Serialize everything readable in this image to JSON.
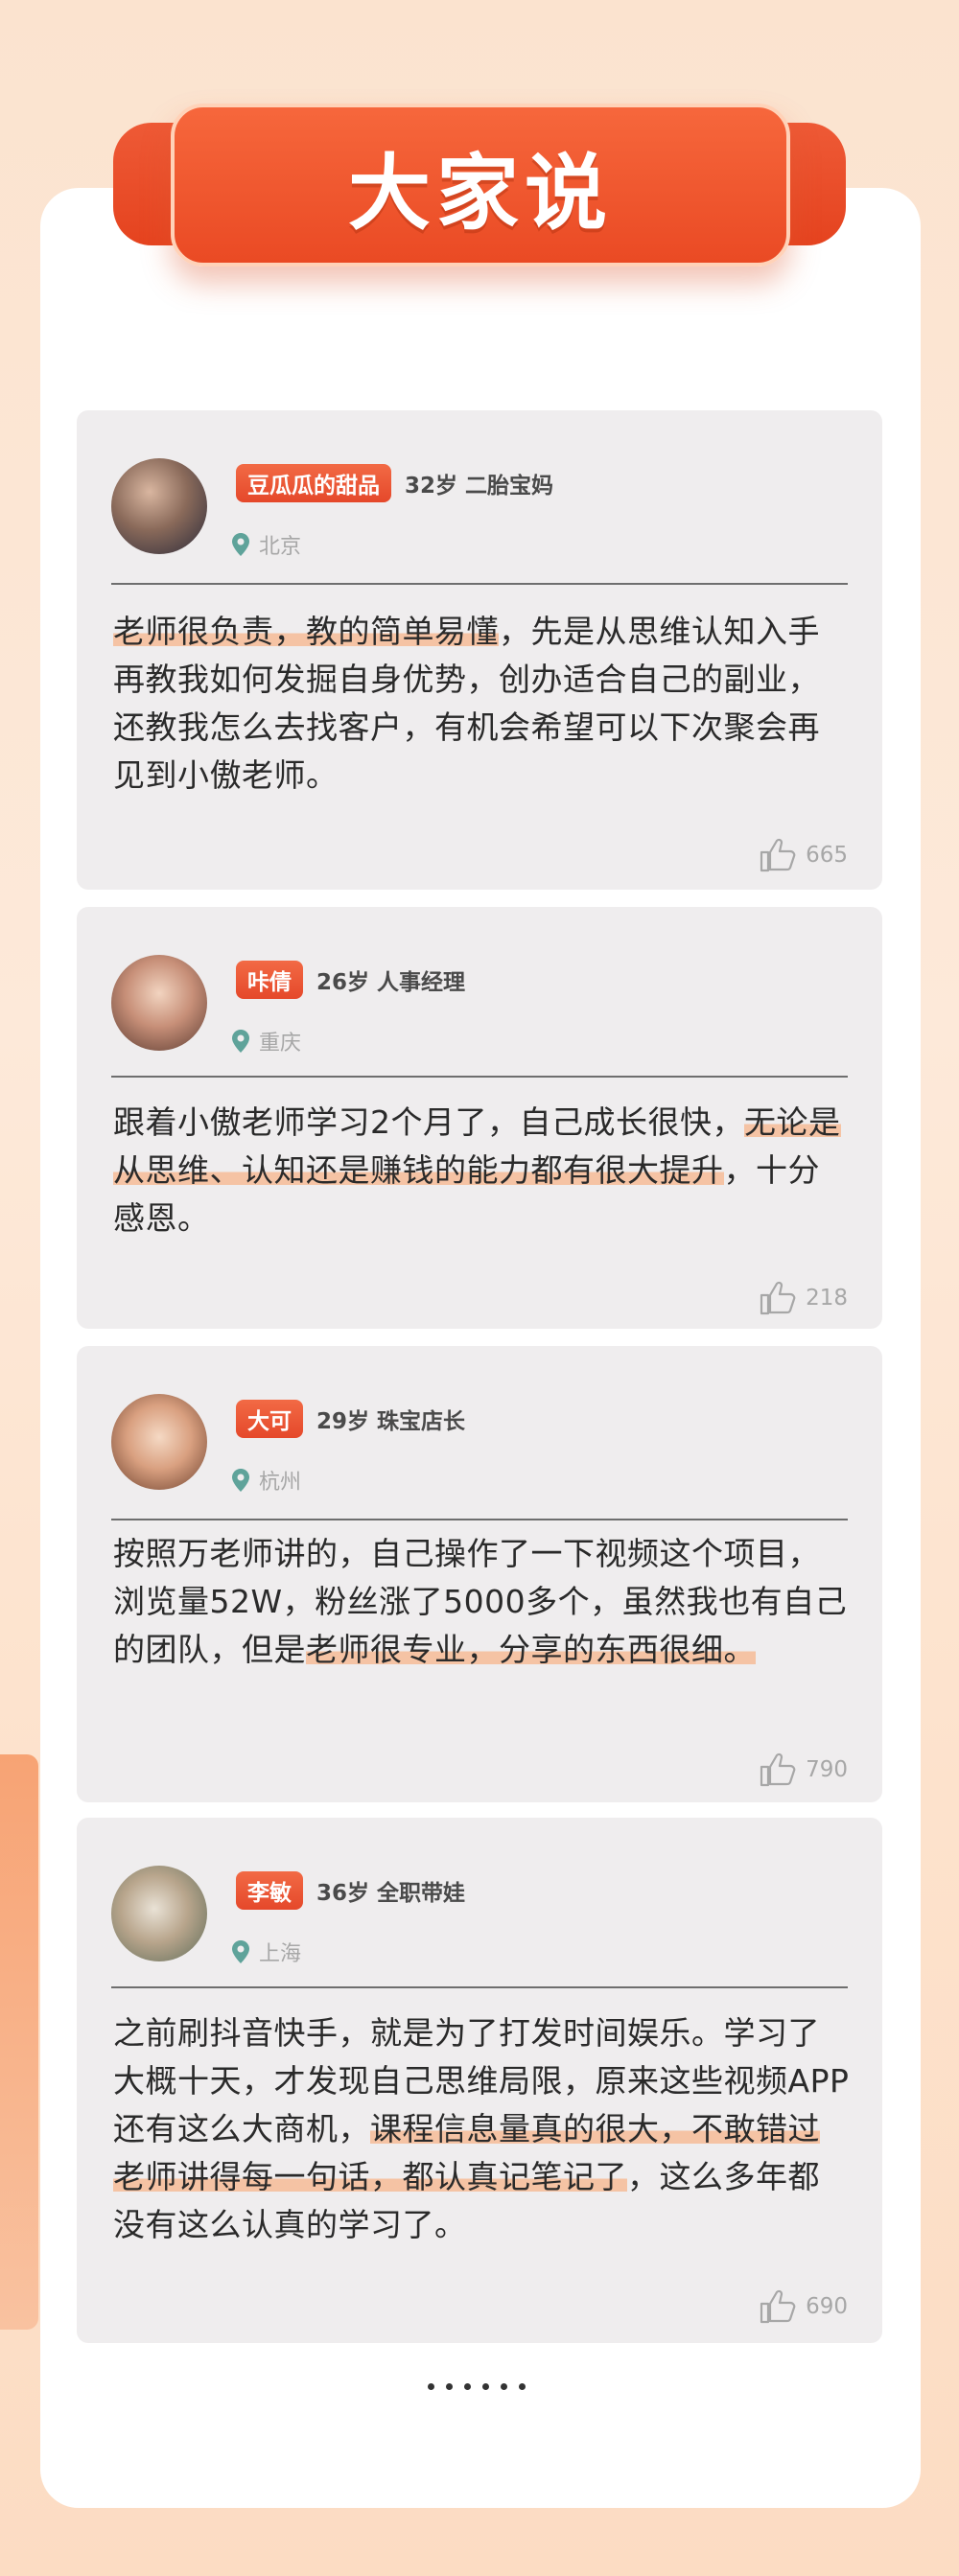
{
  "header": {
    "title": "大家说"
  },
  "testimonials": [
    {
      "name": "豆瓜瓜的甜品",
      "meta": "32岁  二胎宝妈",
      "location": "北京",
      "quote_parts": [
        {
          "text": "老师很负责，教的简单易懂",
          "highlight": true
        },
        {
          "text": "，先是从思维认知入手再教我如何发掘自身优势，创办适合自己的副业，还教我怎么去找客户，有机会希望可以下次聚会再见到小傲老师。",
          "highlight": false
        }
      ],
      "likes": "665"
    },
    {
      "name": "咔倩",
      "meta": "26岁 人事经理",
      "location": "重庆",
      "quote_parts": [
        {
          "text": "跟着小傲老师学习2个月了，自己成长很快，",
          "highlight": false
        },
        {
          "text": "无论是从思维、认知还是赚钱的能力都有很大提升",
          "highlight": true
        },
        {
          "text": "，十分感恩。",
          "highlight": false
        }
      ],
      "likes": "218"
    },
    {
      "name": "大可",
      "meta": "29岁  珠宝店长",
      "location": "杭州",
      "quote_parts": [
        {
          "text": "按照万老师讲的，自己操作了一下视频这个项目，浏览量52W，粉丝涨了5000多个，虽然我也有自己的团队，但是",
          "highlight": false
        },
        {
          "text": "老师很专业，分享的东西很细。",
          "highlight": true
        }
      ],
      "likes": "790"
    },
    {
      "name": "李敏",
      "meta": "36岁  全职带娃",
      "location": "上海",
      "quote_parts": [
        {
          "text": "之前刷抖音快手，就是为了打发时间娱乐。学习了大概十天，才发现自己思维局限，原来这些视频APP还有这么大商机，",
          "highlight": false
        },
        {
          "text": "课程信息量真的很大，不敢错过老师讲得每一句话，都认真记笔记了",
          "highlight": true
        },
        {
          "text": "，这么多年都没有这么认真的学习了。",
          "highlight": false
        }
      ],
      "likes": "690"
    }
  ],
  "pagination": {
    "dot_count": 6
  }
}
